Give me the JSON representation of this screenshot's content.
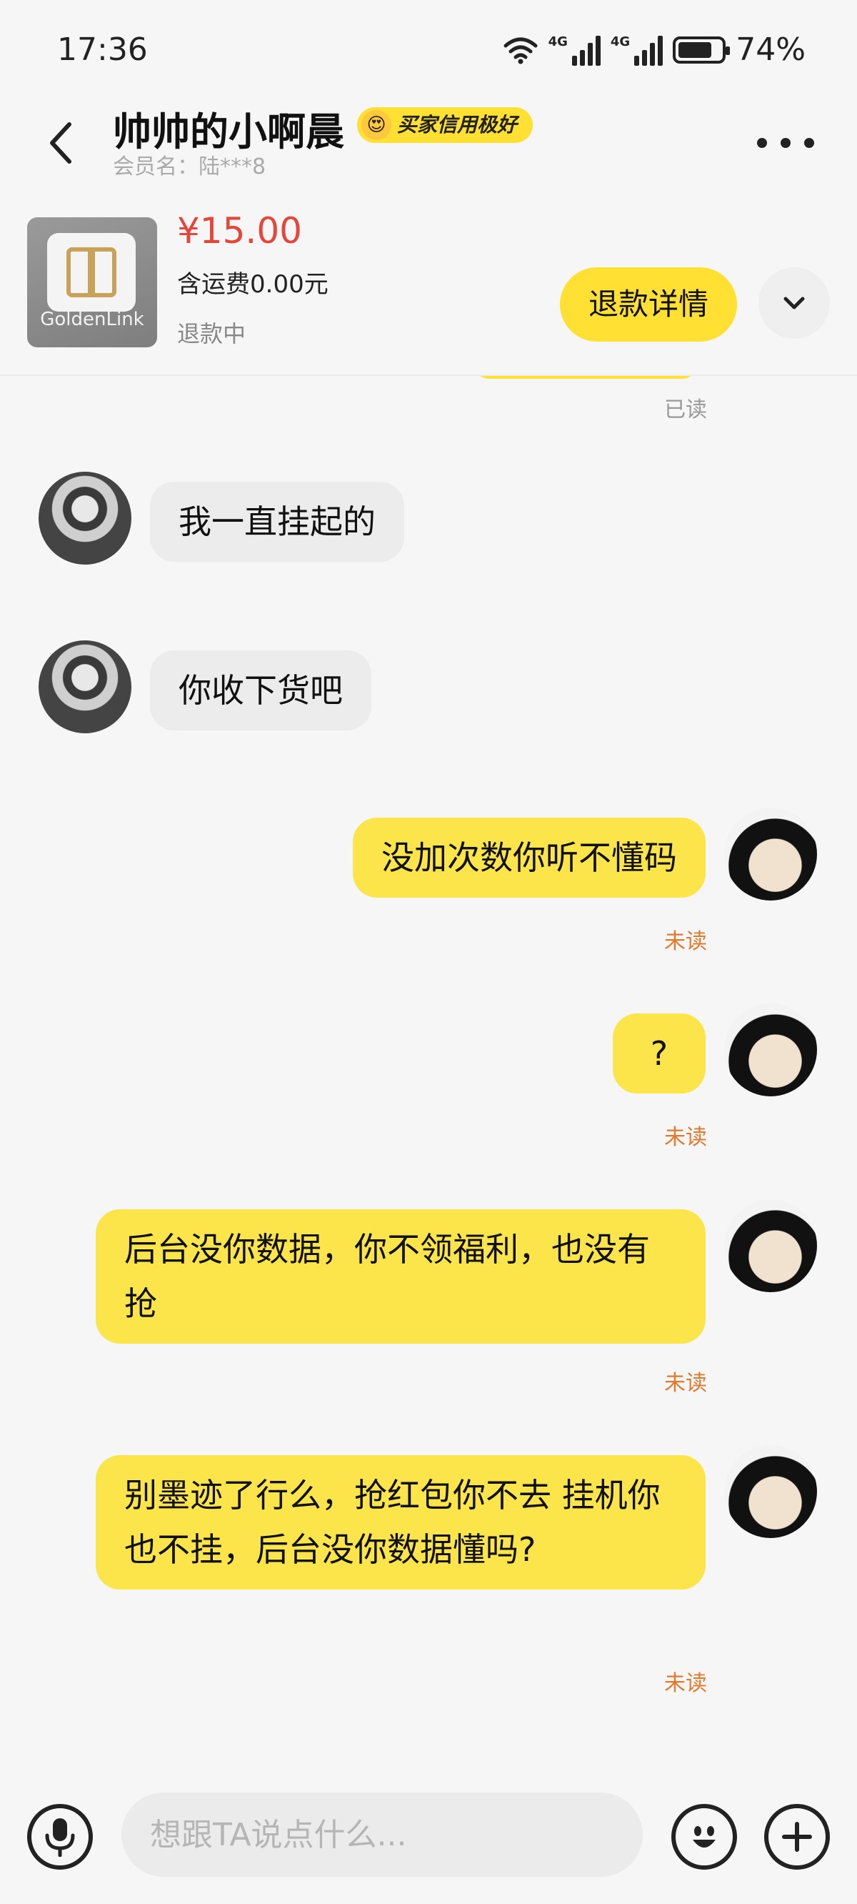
{
  "status_bar": {
    "time": "17:36",
    "network_1": "4G",
    "network_2": "4G",
    "battery": "74%"
  },
  "header": {
    "title": "帅帅的小啊晨",
    "badge": "买家信用极好",
    "member_label": "会员名：陆***8"
  },
  "product": {
    "thumb_text": "GoldenLink",
    "price": "¥15.00",
    "shipping": "含运费0.00元",
    "status": "退款中",
    "refund_button": "退款详情"
  },
  "messages": [
    {
      "side": "in",
      "text": "我一直挂起的"
    },
    {
      "side": "in",
      "text": "你收下货吧"
    },
    {
      "side": "out",
      "text": "没加次数你听不懂码",
      "receipt": "未读"
    },
    {
      "side": "out",
      "text": "?",
      "receipt": "未读"
    },
    {
      "side": "out",
      "text": "后台没你数据，你不领福利，也没有抢",
      "receipt": "未读"
    },
    {
      "side": "out",
      "text": "别墨迹了行么，抢红包你不去  挂机你也不挂，后台没你数据懂吗?",
      "receipt": "未读"
    }
  ],
  "top_receipt": "已读",
  "input": {
    "placeholder": "想跟TA说点什么..."
  },
  "colors": {
    "accent_yellow": "#ffe033",
    "bubble_out": "#fbe54a",
    "bubble_in": "#ececec",
    "price_red": "#e5463a",
    "unread_orange": "#e07a2e"
  },
  "icons": [
    "back-arrow-icon",
    "more-dots-icon",
    "chevron-down-icon",
    "microphone-icon",
    "smile-emoji-icon",
    "plus-icon"
  ]
}
